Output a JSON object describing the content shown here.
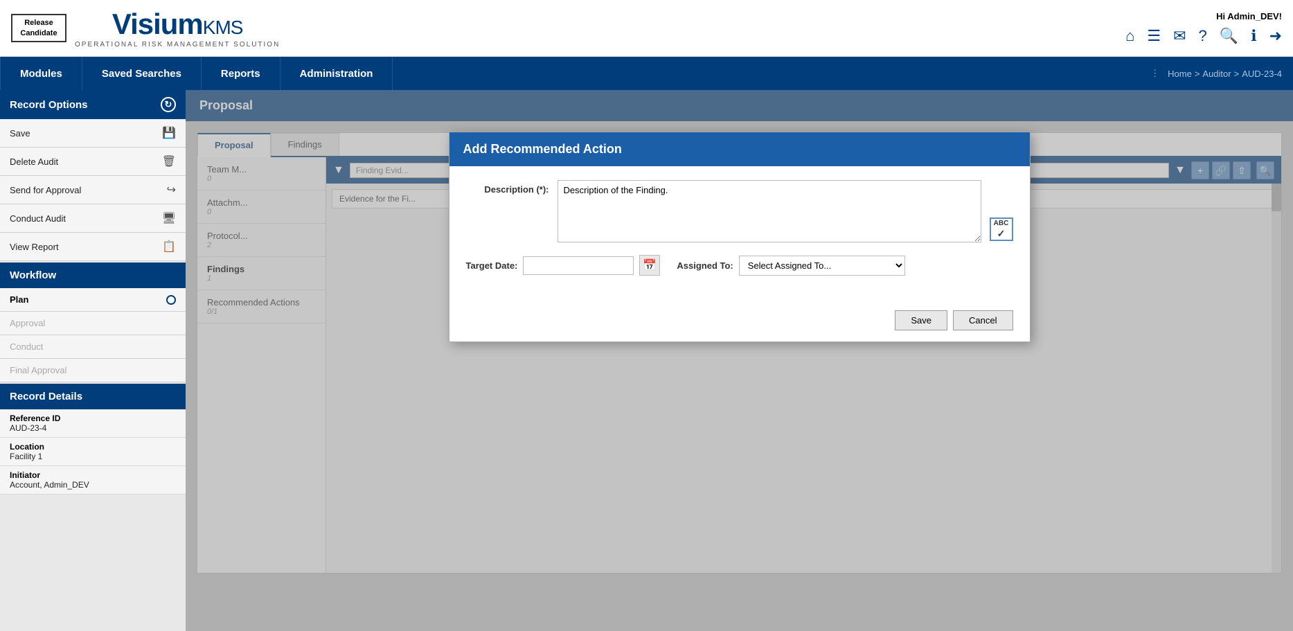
{
  "header": {
    "release_badge_line1": "Release",
    "release_badge_line2": "Candidate",
    "logo_visium": "Visium",
    "logo_kms": "KMS",
    "tagline": "OPERATIONAL RISK MANAGEMENT SOLUTION",
    "user_greeting": "Hi Admin_DEV!",
    "icons": [
      "home",
      "menu",
      "mail",
      "help",
      "search",
      "info",
      "logout"
    ]
  },
  "nav": {
    "items": [
      {
        "label": "Modules"
      },
      {
        "label": "Saved Searches"
      },
      {
        "label": "Reports"
      },
      {
        "label": "Administration"
      }
    ],
    "breadcrumb": {
      "home": "Home",
      "sep1": ">",
      "section": "Auditor",
      "sep2": ">",
      "record": "AUD-23-4"
    }
  },
  "sidebar": {
    "record_options_title": "Record Options",
    "items": [
      {
        "label": "Save",
        "icon": "💾"
      },
      {
        "label": "Delete Audit",
        "icon": "🗑"
      },
      {
        "label": "Send for Approval",
        "icon": "↪"
      },
      {
        "label": "Conduct Audit",
        "icon": "🖥"
      },
      {
        "label": "View Report",
        "icon": "📋"
      }
    ],
    "workflow_title": "Workflow",
    "workflow_items": [
      {
        "label": "Plan",
        "active": true
      },
      {
        "label": "Approval",
        "active": false
      },
      {
        "label": "Conduct",
        "active": false
      },
      {
        "label": "Final Approval",
        "active": false
      }
    ],
    "record_details_title": "Record Details",
    "record_details": [
      {
        "label": "Reference ID",
        "value": "AUD-23-4"
      },
      {
        "label": "Location",
        "value": ""
      },
      {
        "label": "location_sub",
        "value": "Facility 1"
      },
      {
        "label": "Initiator",
        "value": ""
      },
      {
        "label": "initiator_sub",
        "value": "Account, Admin_DEV"
      }
    ]
  },
  "content": {
    "page_title": "Proposal",
    "tabs": [
      {
        "label": "Proposal",
        "active": true
      },
      {
        "label": "Findings",
        "active": false
      }
    ],
    "panel_items": [
      {
        "label": "Team M...",
        "count": "0"
      },
      {
        "label": "Attachm...",
        "count": "0"
      },
      {
        "label": "Protocol...",
        "count": "2"
      },
      {
        "label": "Findings",
        "count": "1",
        "bold": true
      },
      {
        "label": "Recommended Actions",
        "count": "0/1"
      }
    ],
    "right_panel": {
      "filter_placeholder": "Finding Evid...",
      "evidence_item": "Evidence for the Fi..."
    }
  },
  "modal": {
    "title": "Add Recommended Action",
    "description_label": "Description (*):",
    "description_value": "Description of the Finding.",
    "target_date_label": "Target Date:",
    "target_date_value": "",
    "assigned_to_label": "Assigned To:",
    "assigned_to_placeholder": "Select Assigned To...",
    "save_label": "Save",
    "cancel_label": "Cancel"
  }
}
